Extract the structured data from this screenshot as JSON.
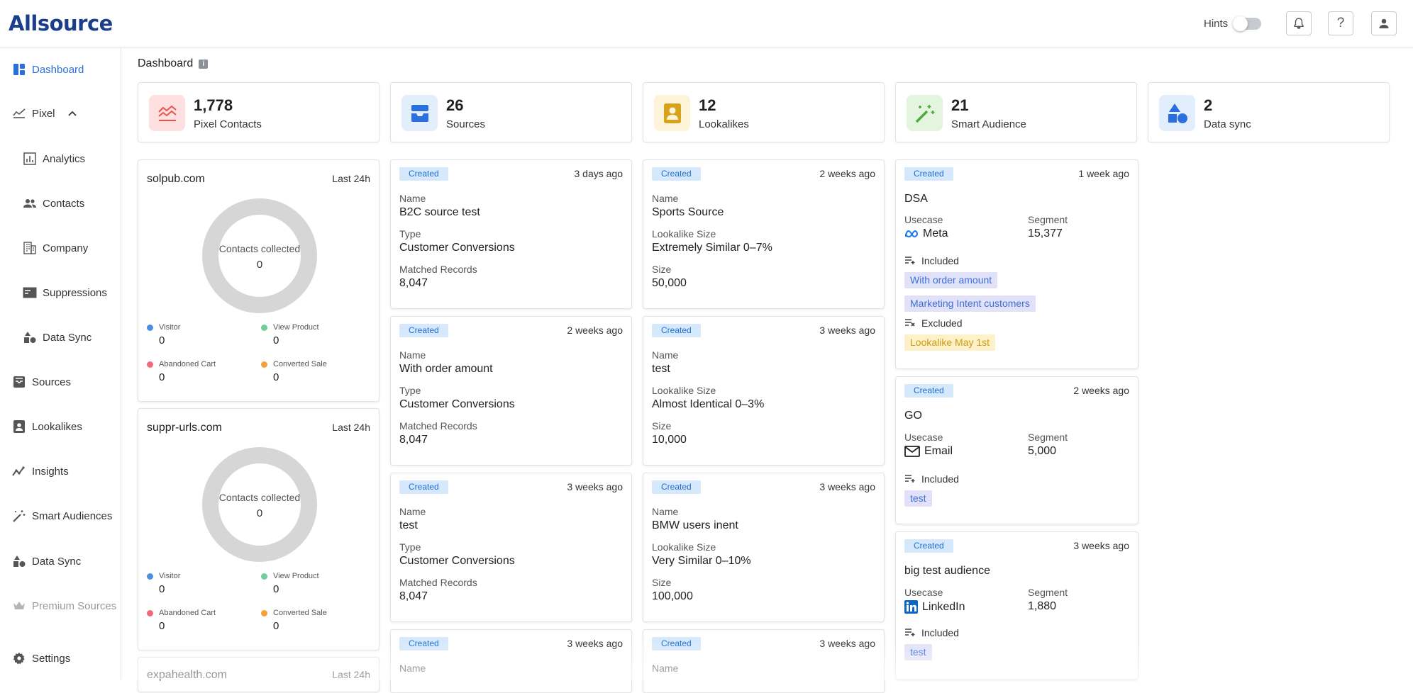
{
  "app": {
    "logo": "Allsource"
  },
  "header": {
    "hints_label": "Hints",
    "hints_on": false,
    "icons": [
      "bell-icon",
      "help-icon",
      "account-icon"
    ]
  },
  "sidebar": {
    "items": [
      {
        "label": "Dashboard",
        "icon": "dashboard-icon",
        "active": true
      },
      {
        "label": "Pixel",
        "icon": "pixel-icon",
        "expanded": true
      },
      {
        "label": "Analytics",
        "icon": "analytics-icon"
      },
      {
        "label": "Contacts",
        "icon": "contacts-icon"
      },
      {
        "label": "Company",
        "icon": "company-icon"
      },
      {
        "label": "Suppressions",
        "icon": "suppressions-icon"
      },
      {
        "label": "Data Sync",
        "icon": "data-sync-icon"
      },
      {
        "label": "Sources",
        "icon": "sources-icon"
      },
      {
        "label": "Lookalikes",
        "icon": "lookalikes-icon"
      },
      {
        "label": "Insights",
        "icon": "insights-icon"
      },
      {
        "label": "Smart Audiences",
        "icon": "smart-audiences-icon"
      },
      {
        "label": "Data Sync",
        "icon": "data-sync-icon"
      },
      {
        "label": "Premium Sources",
        "icon": "crown-icon",
        "disabled": true
      },
      {
        "label": "Settings",
        "icon": "settings-icon"
      }
    ]
  },
  "page": {
    "title": "Dashboard"
  },
  "stats": [
    {
      "value": "1,778",
      "label": "Pixel Contacts",
      "color": "#e8534a",
      "bg": "#fde0df"
    },
    {
      "value": "26",
      "label": "Sources",
      "color": "#2b6fde",
      "bg": "#e3eefc"
    },
    {
      "value": "12",
      "label": "Lookalikes",
      "color": "#d9a21b",
      "bg": "#fdf3d8"
    },
    {
      "value": "21",
      "label": "Smart Audience",
      "color": "#4caa3a",
      "bg": "#e3f5de"
    },
    {
      "value": "2",
      "label": "Data sync",
      "color": "#2b6fde",
      "bg": "#e3eefc"
    }
  ],
  "pixel_cards": [
    {
      "domain": "solpub.com",
      "period": "Last 24h",
      "center_label": "Contacts collected",
      "center_value": "0",
      "legend": [
        {
          "name": "Visitor",
          "value": "0",
          "color": "#4a90e2"
        },
        {
          "name": "View Product",
          "value": "0",
          "color": "#6fcf97"
        },
        {
          "name": "Abandoned Cart",
          "value": "0",
          "color": "#ef6b7a"
        },
        {
          "name": "Converted Sale",
          "value": "0",
          "color": "#f5a23a"
        }
      ]
    },
    {
      "domain": "suppr-urls.com",
      "period": "Last 24h",
      "center_label": "Contacts collected",
      "center_value": "0",
      "legend": [
        {
          "name": "Visitor",
          "value": "0",
          "color": "#4a90e2"
        },
        {
          "name": "View Product",
          "value": "0",
          "color": "#6fcf97"
        },
        {
          "name": "Abandoned Cart",
          "value": "0",
          "color": "#ef6b7a"
        },
        {
          "name": "Converted Sale",
          "value": "0",
          "color": "#f5a23a"
        }
      ]
    },
    {
      "domain": "expahealth.com",
      "period": "Last 24h"
    }
  ],
  "sources": [
    {
      "status": "Created",
      "ago": "3 days ago",
      "name_label": "Name",
      "name": "B2C source test",
      "type_label": "Type",
      "type": "Customer Conversions",
      "records_label": "Matched Records",
      "records": "8,047"
    },
    {
      "status": "Created",
      "ago": "2 weeks ago",
      "name_label": "Name",
      "name": "With order amount",
      "type_label": "Type",
      "type": "Customer Conversions",
      "records_label": "Matched Records",
      "records": "8,047"
    },
    {
      "status": "Created",
      "ago": "3 weeks ago",
      "name_label": "Name",
      "name": "test",
      "type_label": "Type",
      "type": "Customer Conversions",
      "records_label": "Matched Records",
      "records": "8,047"
    },
    {
      "status": "Created",
      "ago": "3 weeks ago",
      "name_label": "Name"
    }
  ],
  "lookalikes": [
    {
      "status": "Created",
      "ago": "2 weeks ago",
      "name_label": "Name",
      "name": "Sports Source",
      "size_label": "Lookalike Size",
      "similarity": "Extremely Similar 0–7%",
      "count_label": "Size",
      "count": "50,000"
    },
    {
      "status": "Created",
      "ago": "3 weeks ago",
      "name_label": "Name",
      "name": "test",
      "size_label": "Lookalike Size",
      "similarity": "Almost Identical 0–3%",
      "count_label": "Size",
      "count": "10,000"
    },
    {
      "status": "Created",
      "ago": "3 weeks ago",
      "name_label": "Name",
      "name": "BMW users inent",
      "size_label": "Lookalike Size",
      "similarity": "Very Similar 0–10%",
      "count_label": "Size",
      "count": "100,000"
    },
    {
      "status": "Created",
      "ago": "3 weeks ago",
      "name_label": "Name"
    }
  ],
  "smart_audiences": [
    {
      "status": "Created",
      "ago": "1 week ago",
      "title": "DSA",
      "usecase_label": "Usecase",
      "usecase": "Meta",
      "usecase_icon": "meta-icon",
      "segment_label": "Segment",
      "segment": "15,377",
      "included_label": "Included",
      "included": [
        "With order amount",
        "Marketing Intent customers"
      ],
      "excluded_label": "Excluded",
      "excluded": [
        "Lookalike May 1st"
      ]
    },
    {
      "status": "Created",
      "ago": "2 weeks ago",
      "title": "GO",
      "usecase_label": "Usecase",
      "usecase": "Email",
      "usecase_icon": "mail-icon",
      "segment_label": "Segment",
      "segment": "5,000",
      "included_label": "Included",
      "included": [
        "test"
      ]
    },
    {
      "status": "Created",
      "ago": "3 weeks ago",
      "title": "big test audience",
      "usecase_label": "Usecase",
      "usecase": "LinkedIn",
      "usecase_icon": "linkedin-icon",
      "segment_label": "Segment",
      "segment": "1,880",
      "included_label": "Included",
      "included": [
        "test"
      ]
    }
  ]
}
